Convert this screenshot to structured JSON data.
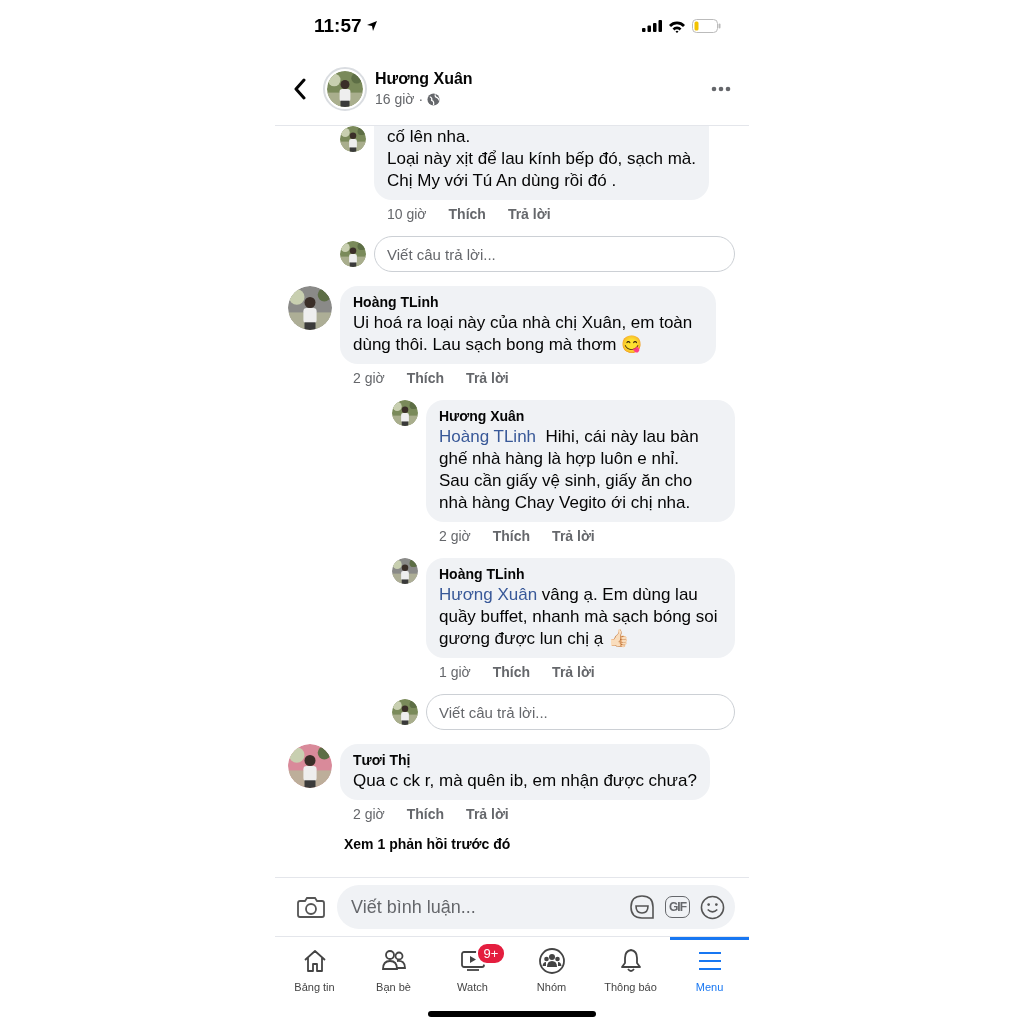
{
  "status_bar": {
    "time": "11:57"
  },
  "header": {
    "title": "Hương Xuân",
    "subtitle": "16 giờ ·"
  },
  "thread": [
    {
      "kind": "continuation",
      "children": [
        {
          "kind": "comment",
          "text": "cố lên nha.\nLoại này xịt để lau kính bếp đó, sạch mà.\nChị My với Tú An dùng rồi đó .",
          "time": "10 giờ",
          "like": "Thích",
          "reply": "Trả lời"
        },
        {
          "kind": "reply_box",
          "placeholder": "Viết câu trả lời..."
        }
      ]
    },
    {
      "kind": "comment",
      "author": "Hoàng TLinh",
      "text": "Ui hoá ra loại này của nhà chị Xuân, em toàn dùng thôi. Lau sạch bong mà thơm 😋",
      "time": "2 giờ",
      "like": "Thích",
      "reply": "Trả lời",
      "children": [
        {
          "kind": "comment",
          "author": "Hương Xuân",
          "mention": "Hoàng TLinh",
          "text": " Hihi, cái này lau bàn ghế nhà hàng là hợp luôn e nhỉ.\nSau cần giấy vệ sinh, giấy ăn cho nhà hàng Chay Vegito ới chị nha.",
          "time": "2 giờ",
          "like": "Thích",
          "reply": "Trả lời"
        },
        {
          "kind": "comment",
          "author": "Hoàng TLinh",
          "mention": "Hương Xuân",
          "text": "vâng ạ. Em dùng lau quầy buffet, nhanh mà sạch bóng soi gương được lun chị ạ 👍🏻",
          "time": "1 giờ",
          "like": "Thích",
          "reply": "Trả lời"
        },
        {
          "kind": "reply_box",
          "placeholder": "Viết câu trả lời..."
        }
      ]
    },
    {
      "kind": "comment",
      "author": "Tươi Thị",
      "text": "Qua c ck r, mà quên ib, em nhận được chưa?",
      "time": "2 giờ",
      "like": "Thích",
      "reply": "Trả lời"
    },
    {
      "kind": "more",
      "text": "Xem 1 phản hồi trước đó"
    }
  ],
  "composer": {
    "placeholder": "Viết bình luận...",
    "gif": "GIF"
  },
  "tabs": [
    {
      "kind": "home",
      "label": "Bảng tin",
      "selected": false
    },
    {
      "kind": "friends",
      "label": "Bạn bè",
      "selected": false
    },
    {
      "kind": "watch",
      "label": "Watch",
      "selected": false,
      "badge": "9+"
    },
    {
      "kind": "groups",
      "label": "Nhóm",
      "selected": false
    },
    {
      "kind": "bell",
      "label": "Thông báo",
      "selected": false
    },
    {
      "kind": "menu",
      "label": "Menu",
      "selected": true
    }
  ]
}
